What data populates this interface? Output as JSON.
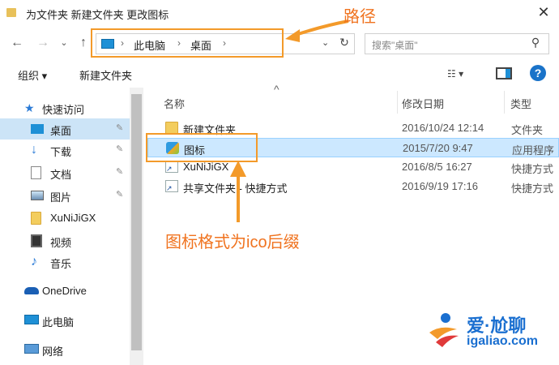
{
  "window": {
    "title": "为文件夹 新建文件夹 更改图标",
    "close_glyph": "✕"
  },
  "nav": {
    "back_glyph": "←",
    "forward_glyph": "→",
    "recent_glyph": "⌄",
    "up_glyph": "↑",
    "breadcrumbs": [
      "此电脑",
      "桌面"
    ],
    "crumb_sep": "›",
    "dropdown_glyph": "⌄",
    "refresh_glyph": "↻",
    "search_placeholder": "搜索\"桌面\"",
    "search_glyph": "⚲"
  },
  "toolbar": {
    "organize_label": "组织 ▾",
    "new_folder_label": "新建文件夹",
    "view_glyph": "☷ ▾",
    "help_glyph": "?"
  },
  "sidebar": {
    "items": [
      {
        "label": "快速访问",
        "icon": "star-icon",
        "pinned": false
      },
      {
        "label": "桌面",
        "icon": "desktop-icon",
        "pinned": true,
        "selected": true
      },
      {
        "label": "下载",
        "icon": "download-icon",
        "pinned": true
      },
      {
        "label": "文档",
        "icon": "document-icon",
        "pinned": true
      },
      {
        "label": "图片",
        "icon": "picture-icon",
        "pinned": true
      },
      {
        "label": "XuNiJiGX",
        "icon": "folder-icon",
        "pinned": false
      },
      {
        "label": "视频",
        "icon": "video-icon",
        "pinned": false
      },
      {
        "label": "音乐",
        "icon": "music-icon",
        "pinned": false
      },
      {
        "label": "OneDrive",
        "icon": "cloud-icon",
        "pinned": false
      },
      {
        "label": "此电脑",
        "icon": "computer-icon",
        "pinned": false
      },
      {
        "label": "网络",
        "icon": "network-icon",
        "pinned": false
      }
    ],
    "pin_glyph": "✎"
  },
  "columns": {
    "name": "名称",
    "date": "修改日期",
    "type": "类型",
    "sort_glyph": "^"
  },
  "files": [
    {
      "name": "新建文件夹",
      "date": "2016/10/24 12:14",
      "type": "文件夹",
      "icon": "folder-icon"
    },
    {
      "name": "图标",
      "date": "2015/7/20 9:47",
      "type": "应用程序",
      "icon": "app-icon",
      "selected": true
    },
    {
      "name": "XuNiJiGX",
      "date": "2016/8/5 16:27",
      "type": "快捷方式",
      "icon": "shortcut-icon"
    },
    {
      "name": "共享文件夹 - 快捷方式",
      "date": "2016/9/19 17:16",
      "type": "快捷方式",
      "icon": "shortcut-icon"
    }
  ],
  "annotations": {
    "path_label": "路径",
    "icon_format_label": "图标格式为ico后缀"
  },
  "logo": {
    "brand": "爱·尬聊",
    "url": "igaliao.com"
  },
  "colors": {
    "annotation": "#f39a2a",
    "selection": "#cce8ff",
    "accent": "#1a6fd0"
  }
}
